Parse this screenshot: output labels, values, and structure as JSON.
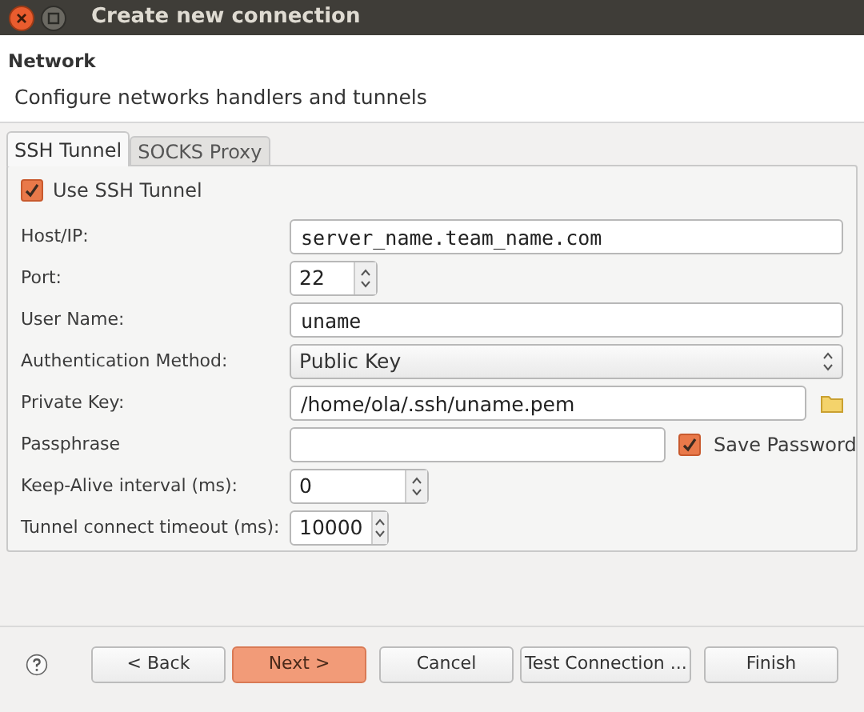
{
  "window": {
    "title": "Create new connection"
  },
  "header": {
    "title": "Network",
    "description": "Configure networks handlers and tunnels"
  },
  "tabs": [
    {
      "label": "SSH Tunnel",
      "selected": true
    },
    {
      "label": "SOCKS Proxy",
      "selected": false
    }
  ],
  "use_ssh_tunnel": {
    "label": "Use SSH Tunnel",
    "checked": true
  },
  "fields": [
    {
      "kind": "text",
      "label": "Host/IP:",
      "value": "server_name.team_name.com",
      "monospace": true
    },
    {
      "kind": "spin",
      "label": "Port:",
      "value": "22"
    },
    {
      "kind": "text",
      "label": "User Name:",
      "value": "uname",
      "monospace": true
    },
    {
      "kind": "select",
      "label": "Authentication Method:",
      "value": "Public Key"
    },
    {
      "kind": "file",
      "label": "Private Key:",
      "value": "/home/ola/.ssh/uname.pem"
    },
    {
      "kind": "secret",
      "label": "Passphrase",
      "save_label": "Save Password",
      "save_checked": true
    },
    {
      "kind": "spin",
      "label": "Keep-Alive interval (ms):",
      "value": "0"
    },
    {
      "kind": "spin",
      "label": "Tunnel connect timeout (ms):",
      "value": "10000"
    }
  ],
  "buttons": [
    {
      "label": "< Back",
      "primary": false
    },
    {
      "label": "Next >",
      "primary": true
    },
    {
      "label": "Cancel",
      "primary": false
    },
    {
      "label": "Test Connection ...",
      "primary": false
    },
    {
      "label": "Finish",
      "primary": false
    }
  ]
}
